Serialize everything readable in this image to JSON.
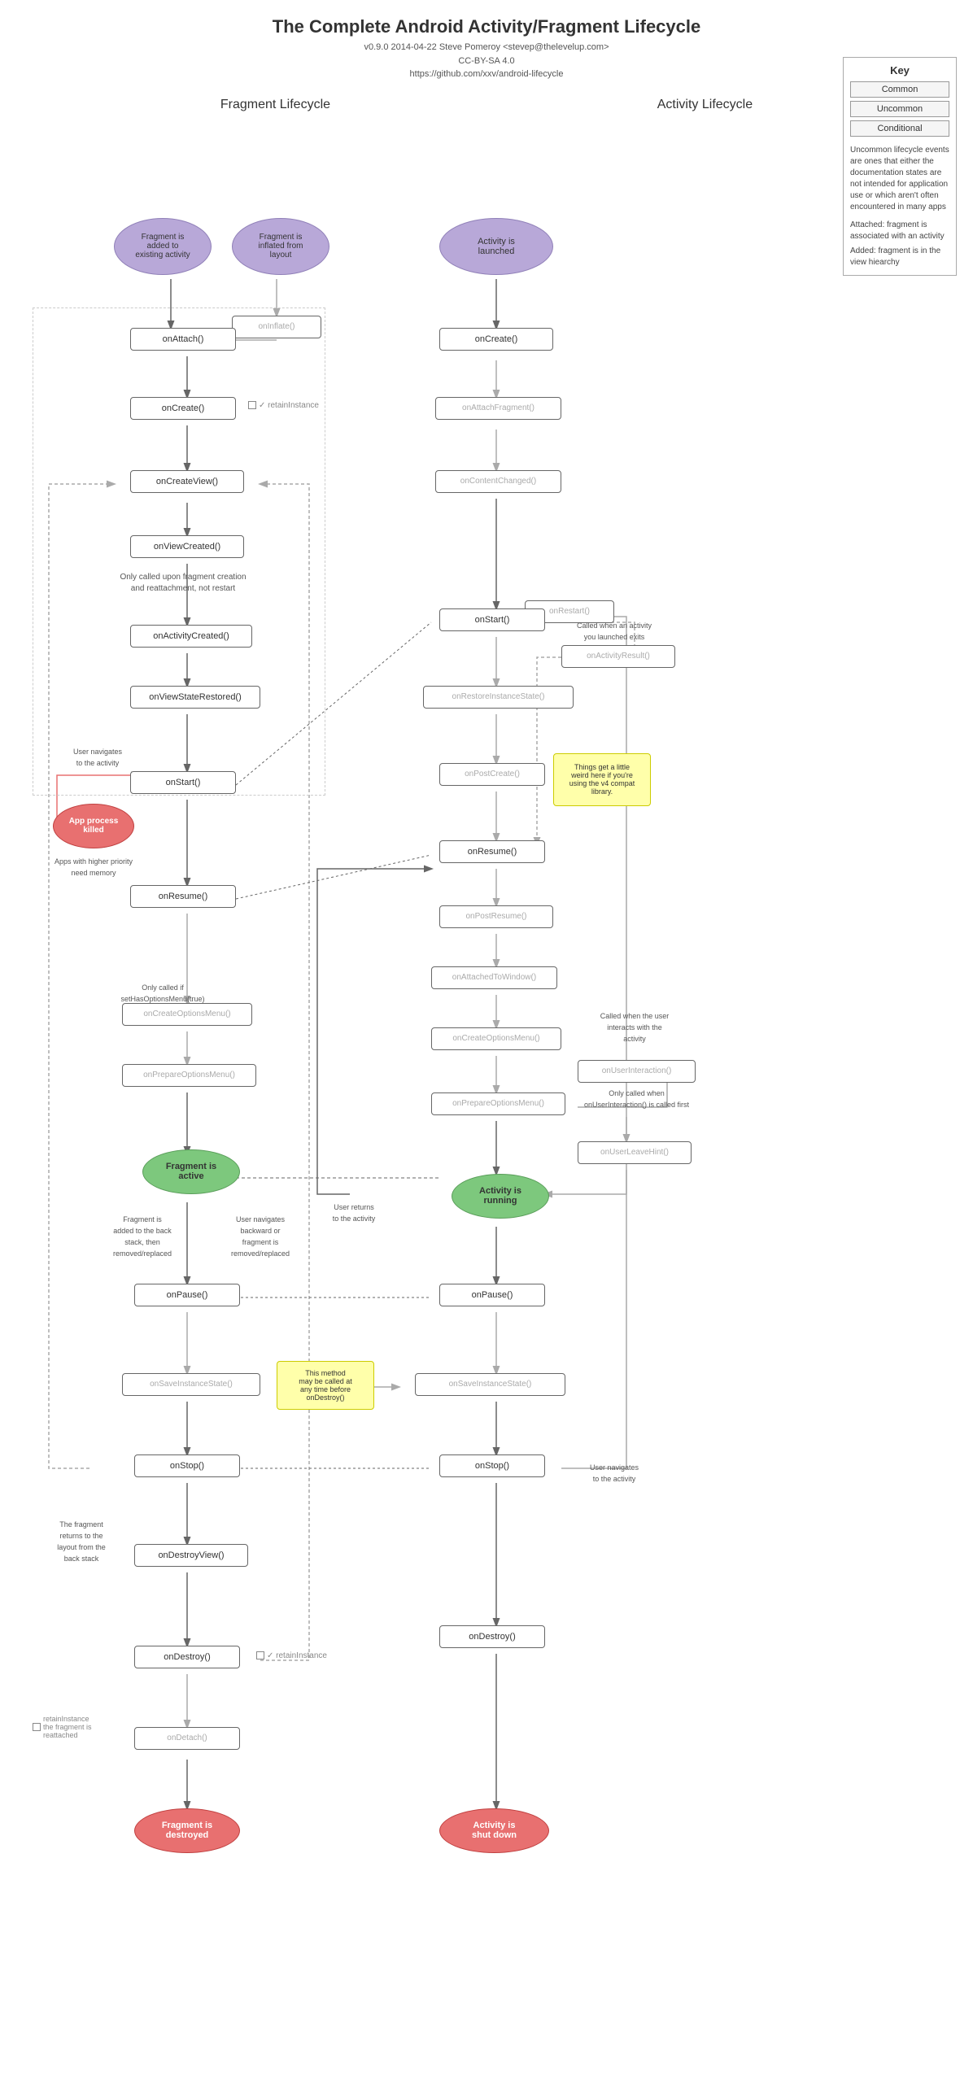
{
  "title": "The Complete Android Activity/Fragment Lifecycle",
  "subtitle_line1": "v0.9.0 2014-04-22 Steve Pomeroy <stevep@thelevelup.com>",
  "subtitle_line2": "CC-BY-SA 4.0",
  "subtitle_line3": "https://github.com/xxv/android-lifecycle",
  "key": {
    "title": "Key",
    "items": [
      "Common",
      "Uncommon",
      "Conditional"
    ]
  },
  "key_desc1": "Uncommon lifecycle events are ones that either the documentation states are not intended for application use or which aren't often encountered in many apps",
  "key_desc2": "Attached: fragment is associated with an activity",
  "key_desc3": "Added: fragment is in the view hiearchy",
  "section_fragment": "Fragment Lifecycle",
  "section_activity": "Activity Lifecycle",
  "nodes": {
    "fragment_start1": "Fragment is\nadded to\nexisting activity",
    "fragment_start2": "Fragment is\ninflated from\nlayout",
    "activity_launched": "Activity is\nlaunched",
    "onInflate": "onInflate()",
    "onAttach": "onAttach()",
    "onCreate_frag": "onCreate()",
    "retainInstance1": "✓ retainInstance",
    "onCreateView": "onCreateView()",
    "onViewCreated": "onViewCreated()",
    "onAttachFragment": "onAttachFragment()",
    "onCreate_act": "onCreate()",
    "onContentChanged": "onContentChanged()",
    "note_onlyCalledUpon": "Only called upon fragment creation\nand reattachment, not restart",
    "onActivityCreated": "onActivityCreated()",
    "onViewStateRestored": "onViewStateRestored()",
    "onRestart": "onRestart()",
    "onStart_act": "onStart()",
    "onActivityResult": "onActivityResult()",
    "note_calledWhenActivity": "Called when an activity\nyou launched exits",
    "onRestoreInstanceState": "onRestoreInstanceState()",
    "onStart_frag": "onStart()",
    "note_userNavigates": "User navigates\nto the activity",
    "app_process_killed": "App process\nkilled",
    "note_appsHigher": "Apps with higher priority\nneed memory",
    "onPostCreate": "onPostCreate()",
    "note_thingsGetWeird": "Things get a little\nweird here if you're\nusing the v4 compat\nlibrary.",
    "onResume_frag": "onResume()",
    "onResume_act": "onResume()",
    "onPostResume": "onPostResume()",
    "onAttachedToWindow": "onAttachedToWindow()",
    "onCreateOptionsMenu": "onCreateOptionsMenu()",
    "onPrepareOptionsMenu_act": "onPrepareOptionsMenu()",
    "note_calledWhenUser": "Called when the user\ninteracts with the\nactivity",
    "onUserInteraction": "onUserInteraction()",
    "note_onlyCalled": "Only called when\nonUserInteraction() is called first",
    "onUserLeaveHint": "onUserLeaveHint()",
    "fragment_active": "Fragment is\nactive",
    "activity_running": "Activity is\nrunning",
    "note_userReturns": "User returns\nto the activity",
    "note_fragAddedToBackStack": "Fragment is\nadded to the back\nstack, then\nremoved/replaced",
    "note_userNavigatesBackward": "User navigates\nbackward or\nfragment is\nremoved/replaced",
    "onCreateOptionsMenu_frag": "onCreateOptionsMenu()",
    "onPrepareOptionsMenu_frag": "onPrepareOptionsMenu()",
    "note_onlyCalledIf": "Only called if\nsetHasOptionsMenu(true)",
    "onPause_frag": "onPause()",
    "onPause_act": "onPause()",
    "note_thisMethod": "This method\nmay be called at\nany time before\nonDestroy()",
    "onSaveInstanceState_frag": "onSaveInstanceState()",
    "onSaveInstanceState_act": "onSaveInstanceState()",
    "onStop_frag": "onStop()",
    "onStop_act": "onStop()",
    "note_userNavigatesToActivity": "User navigates\nto the activity",
    "note_fragReturns": "The fragment\nreturns to the\nlayout from the\nback stack",
    "onDestroyView": "onDestroyView()",
    "retainInstance2": "✓ retainInstance",
    "onDestroy_frag": "onDestroy()",
    "onDestroy_act": "onDestroy()",
    "onDetach": "onDetach()",
    "fragment_destroyed": "Fragment is\ndestroyed",
    "activity_shutdown": "Activity is\nshut down"
  }
}
